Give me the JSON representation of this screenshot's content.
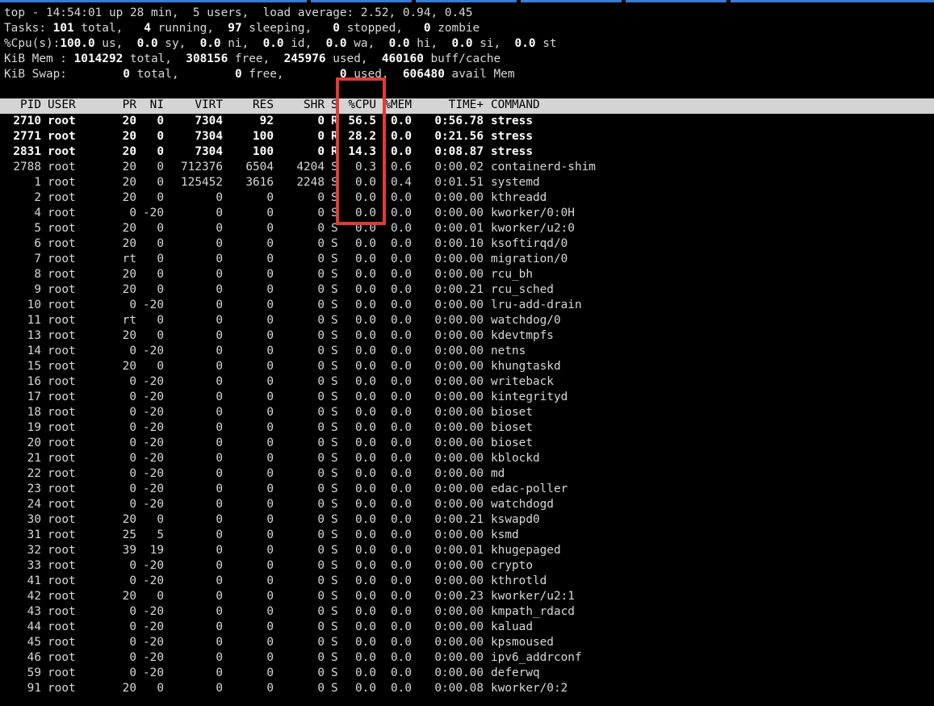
{
  "summary": {
    "line1": "top - 14:54:01 up 28 min,  5 users,  load average: 2.52, 0.94, 0.45",
    "tasks": {
      "label": "Tasks:",
      "total": "101",
      "t1": " total,   ",
      "running": "4",
      "t2": " running,  ",
      "sleeping": "97",
      "t3": " sleeping,   ",
      "stopped": "0",
      "t4": " stopped,   ",
      "zombie": "0",
      "t5": " zombie"
    },
    "cpu": {
      "label": "%Cpu(s):",
      "us": "100.0",
      "t1": " us,  ",
      "sy": "0.0",
      "t2": " sy,  ",
      "ni": "0.0",
      "t3": " ni,  ",
      "id": "0.0",
      "t4": " id,  ",
      "wa": "0.0",
      "t5": " wa,  ",
      "hi": "0.0",
      "t6": " hi,  ",
      "si": "0.0",
      "t7": " si,  ",
      "st": "0.0",
      "t8": " st"
    },
    "mem": {
      "label": "KiB Mem : ",
      "total": "1014292",
      "t1": " total,  ",
      "free": "308156",
      "t2": " free,  ",
      "used": "245976",
      "t3": " used,  ",
      "cache": "460160",
      "t4": " buff/cache"
    },
    "swap": {
      "label": "KiB Swap:        ",
      "total": "0",
      "t1": " total,        ",
      "free": "0",
      "t2": " free,        ",
      "used": "0",
      "t3": " used.  ",
      "avail": "606480",
      "t4": " avail Mem"
    }
  },
  "columns": {
    "pid": "PID",
    "user": "USER",
    "pr": "PR",
    "ni": "NI",
    "virt": "VIRT",
    "res": "RES",
    "shr": "SHR",
    "s": "S",
    "cpu": "%CPU",
    "mem": "%MEM",
    "time": "TIME+",
    "command": "COMMAND"
  },
  "processes": [
    {
      "pid": "2710",
      "user": "root",
      "pr": "20",
      "ni": "0",
      "virt": "7304",
      "res": "92",
      "shr": "0",
      "s": "R",
      "cpu": "56.5",
      "mem": "0.0",
      "time": "0:56.78",
      "command": "stress"
    },
    {
      "pid": "2771",
      "user": "root",
      "pr": "20",
      "ni": "0",
      "virt": "7304",
      "res": "100",
      "shr": "0",
      "s": "R",
      "cpu": "28.2",
      "mem": "0.0",
      "time": "0:21.56",
      "command": "stress"
    },
    {
      "pid": "2831",
      "user": "root",
      "pr": "20",
      "ni": "0",
      "virt": "7304",
      "res": "100",
      "shr": "0",
      "s": "R",
      "cpu": "14.3",
      "mem": "0.0",
      "time": "0:08.87",
      "command": "stress"
    },
    {
      "pid": "2788",
      "user": "root",
      "pr": "20",
      "ni": "0",
      "virt": "712376",
      "res": "6504",
      "shr": "4204",
      "s": "S",
      "cpu": "0.3",
      "mem": "0.6",
      "time": "0:00.02",
      "command": "containerd-shim"
    },
    {
      "pid": "1",
      "user": "root",
      "pr": "20",
      "ni": "0",
      "virt": "125452",
      "res": "3616",
      "shr": "2248",
      "s": "S",
      "cpu": "0.0",
      "mem": "0.4",
      "time": "0:01.51",
      "command": "systemd"
    },
    {
      "pid": "2",
      "user": "root",
      "pr": "20",
      "ni": "0",
      "virt": "0",
      "res": "0",
      "shr": "0",
      "s": "S",
      "cpu": "0.0",
      "mem": "0.0",
      "time": "0:00.00",
      "command": "kthreadd"
    },
    {
      "pid": "4",
      "user": "root",
      "pr": "0",
      "ni": "-20",
      "virt": "0",
      "res": "0",
      "shr": "0",
      "s": "S",
      "cpu": "0.0",
      "mem": "0.0",
      "time": "0:00.00",
      "command": "kworker/0:0H"
    },
    {
      "pid": "5",
      "user": "root",
      "pr": "20",
      "ni": "0",
      "virt": "0",
      "res": "0",
      "shr": "0",
      "s": "S",
      "cpu": "0.0",
      "mem": "0.0",
      "time": "0:00.01",
      "command": "kworker/u2:0"
    },
    {
      "pid": "6",
      "user": "root",
      "pr": "20",
      "ni": "0",
      "virt": "0",
      "res": "0",
      "shr": "0",
      "s": "S",
      "cpu": "0.0",
      "mem": "0.0",
      "time": "0:00.10",
      "command": "ksoftirqd/0"
    },
    {
      "pid": "7",
      "user": "root",
      "pr": "rt",
      "ni": "0",
      "virt": "0",
      "res": "0",
      "shr": "0",
      "s": "S",
      "cpu": "0.0",
      "mem": "0.0",
      "time": "0:00.00",
      "command": "migration/0"
    },
    {
      "pid": "8",
      "user": "root",
      "pr": "20",
      "ni": "0",
      "virt": "0",
      "res": "0",
      "shr": "0",
      "s": "S",
      "cpu": "0.0",
      "mem": "0.0",
      "time": "0:00.00",
      "command": "rcu_bh"
    },
    {
      "pid": "9",
      "user": "root",
      "pr": "20",
      "ni": "0",
      "virt": "0",
      "res": "0",
      "shr": "0",
      "s": "S",
      "cpu": "0.0",
      "mem": "0.0",
      "time": "0:00.21",
      "command": "rcu_sched"
    },
    {
      "pid": "10",
      "user": "root",
      "pr": "0",
      "ni": "-20",
      "virt": "0",
      "res": "0",
      "shr": "0",
      "s": "S",
      "cpu": "0.0",
      "mem": "0.0",
      "time": "0:00.00",
      "command": "lru-add-drain"
    },
    {
      "pid": "11",
      "user": "root",
      "pr": "rt",
      "ni": "0",
      "virt": "0",
      "res": "0",
      "shr": "0",
      "s": "S",
      "cpu": "0.0",
      "mem": "0.0",
      "time": "0:00.00",
      "command": "watchdog/0"
    },
    {
      "pid": "13",
      "user": "root",
      "pr": "20",
      "ni": "0",
      "virt": "0",
      "res": "0",
      "shr": "0",
      "s": "S",
      "cpu": "0.0",
      "mem": "0.0",
      "time": "0:00.00",
      "command": "kdevtmpfs"
    },
    {
      "pid": "14",
      "user": "root",
      "pr": "0",
      "ni": "-20",
      "virt": "0",
      "res": "0",
      "shr": "0",
      "s": "S",
      "cpu": "0.0",
      "mem": "0.0",
      "time": "0:00.00",
      "command": "netns"
    },
    {
      "pid": "15",
      "user": "root",
      "pr": "20",
      "ni": "0",
      "virt": "0",
      "res": "0",
      "shr": "0",
      "s": "S",
      "cpu": "0.0",
      "mem": "0.0",
      "time": "0:00.00",
      "command": "khungtaskd"
    },
    {
      "pid": "16",
      "user": "root",
      "pr": "0",
      "ni": "-20",
      "virt": "0",
      "res": "0",
      "shr": "0",
      "s": "S",
      "cpu": "0.0",
      "mem": "0.0",
      "time": "0:00.00",
      "command": "writeback"
    },
    {
      "pid": "17",
      "user": "root",
      "pr": "0",
      "ni": "-20",
      "virt": "0",
      "res": "0",
      "shr": "0",
      "s": "S",
      "cpu": "0.0",
      "mem": "0.0",
      "time": "0:00.00",
      "command": "kintegrityd"
    },
    {
      "pid": "18",
      "user": "root",
      "pr": "0",
      "ni": "-20",
      "virt": "0",
      "res": "0",
      "shr": "0",
      "s": "S",
      "cpu": "0.0",
      "mem": "0.0",
      "time": "0:00.00",
      "command": "bioset"
    },
    {
      "pid": "19",
      "user": "root",
      "pr": "0",
      "ni": "-20",
      "virt": "0",
      "res": "0",
      "shr": "0",
      "s": "S",
      "cpu": "0.0",
      "mem": "0.0",
      "time": "0:00.00",
      "command": "bioset"
    },
    {
      "pid": "20",
      "user": "root",
      "pr": "0",
      "ni": "-20",
      "virt": "0",
      "res": "0",
      "shr": "0",
      "s": "S",
      "cpu": "0.0",
      "mem": "0.0",
      "time": "0:00.00",
      "command": "bioset"
    },
    {
      "pid": "21",
      "user": "root",
      "pr": "0",
      "ni": "-20",
      "virt": "0",
      "res": "0",
      "shr": "0",
      "s": "S",
      "cpu": "0.0",
      "mem": "0.0",
      "time": "0:00.00",
      "command": "kblockd"
    },
    {
      "pid": "22",
      "user": "root",
      "pr": "0",
      "ni": "-20",
      "virt": "0",
      "res": "0",
      "shr": "0",
      "s": "S",
      "cpu": "0.0",
      "mem": "0.0",
      "time": "0:00.00",
      "command": "md"
    },
    {
      "pid": "23",
      "user": "root",
      "pr": "0",
      "ni": "-20",
      "virt": "0",
      "res": "0",
      "shr": "0",
      "s": "S",
      "cpu": "0.0",
      "mem": "0.0",
      "time": "0:00.00",
      "command": "edac-poller"
    },
    {
      "pid": "24",
      "user": "root",
      "pr": "0",
      "ni": "-20",
      "virt": "0",
      "res": "0",
      "shr": "0",
      "s": "S",
      "cpu": "0.0",
      "mem": "0.0",
      "time": "0:00.00",
      "command": "watchdogd"
    },
    {
      "pid": "30",
      "user": "root",
      "pr": "20",
      "ni": "0",
      "virt": "0",
      "res": "0",
      "shr": "0",
      "s": "S",
      "cpu": "0.0",
      "mem": "0.0",
      "time": "0:00.21",
      "command": "kswapd0"
    },
    {
      "pid": "31",
      "user": "root",
      "pr": "25",
      "ni": "5",
      "virt": "0",
      "res": "0",
      "shr": "0",
      "s": "S",
      "cpu": "0.0",
      "mem": "0.0",
      "time": "0:00.00",
      "command": "ksmd"
    },
    {
      "pid": "32",
      "user": "root",
      "pr": "39",
      "ni": "19",
      "virt": "0",
      "res": "0",
      "shr": "0",
      "s": "S",
      "cpu": "0.0",
      "mem": "0.0",
      "time": "0:00.01",
      "command": "khugepaged"
    },
    {
      "pid": "33",
      "user": "root",
      "pr": "0",
      "ni": "-20",
      "virt": "0",
      "res": "0",
      "shr": "0",
      "s": "S",
      "cpu": "0.0",
      "mem": "0.0",
      "time": "0:00.00",
      "command": "crypto"
    },
    {
      "pid": "41",
      "user": "root",
      "pr": "0",
      "ni": "-20",
      "virt": "0",
      "res": "0",
      "shr": "0",
      "s": "S",
      "cpu": "0.0",
      "mem": "0.0",
      "time": "0:00.00",
      "command": "kthrotld"
    },
    {
      "pid": "42",
      "user": "root",
      "pr": "20",
      "ni": "0",
      "virt": "0",
      "res": "0",
      "shr": "0",
      "s": "S",
      "cpu": "0.0",
      "mem": "0.0",
      "time": "0:00.23",
      "command": "kworker/u2:1"
    },
    {
      "pid": "43",
      "user": "root",
      "pr": "0",
      "ni": "-20",
      "virt": "0",
      "res": "0",
      "shr": "0",
      "s": "S",
      "cpu": "0.0",
      "mem": "0.0",
      "time": "0:00.00",
      "command": "kmpath_rdacd"
    },
    {
      "pid": "44",
      "user": "root",
      "pr": "0",
      "ni": "-20",
      "virt": "0",
      "res": "0",
      "shr": "0",
      "s": "S",
      "cpu": "0.0",
      "mem": "0.0",
      "time": "0:00.00",
      "command": "kaluad"
    },
    {
      "pid": "45",
      "user": "root",
      "pr": "0",
      "ni": "-20",
      "virt": "0",
      "res": "0",
      "shr": "0",
      "s": "S",
      "cpu": "0.0",
      "mem": "0.0",
      "time": "0:00.00",
      "command": "kpsmoused"
    },
    {
      "pid": "46",
      "user": "root",
      "pr": "0",
      "ni": "-20",
      "virt": "0",
      "res": "0",
      "shr": "0",
      "s": "S",
      "cpu": "0.0",
      "mem": "0.0",
      "time": "0:00.00",
      "command": "ipv6_addrconf"
    },
    {
      "pid": "59",
      "user": "root",
      "pr": "0",
      "ni": "-20",
      "virt": "0",
      "res": "0",
      "shr": "0",
      "s": "S",
      "cpu": "0.0",
      "mem": "0.0",
      "time": "0:00.00",
      "command": "deferwq"
    },
    {
      "pid": "91",
      "user": "root",
      "pr": "20",
      "ni": "0",
      "virt": "0",
      "res": "0",
      "shr": "0",
      "s": "S",
      "cpu": "0.0",
      "mem": "0.0",
      "time": "0:00.08",
      "command": "kworker/0:2"
    }
  ],
  "highlight_color": "#e53935"
}
